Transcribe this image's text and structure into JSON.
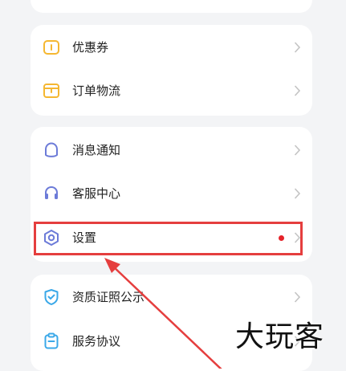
{
  "menu": {
    "group1": {
      "coupon": {
        "label": "优惠券",
        "icon": "coupon-icon"
      },
      "orders": {
        "label": "订单物流",
        "icon": "package-icon"
      }
    },
    "group2": {
      "notifications": {
        "label": "消息通知",
        "icon": "bell-icon"
      },
      "service": {
        "label": "客服中心",
        "icon": "headset-icon"
      },
      "settings": {
        "label": "设置",
        "icon": "settings-hexagon-icon",
        "has_badge": true
      }
    },
    "group3": {
      "license": {
        "label": "资质证照公示",
        "icon": "shield-check-icon"
      },
      "agreement": {
        "label": "服务协议",
        "icon": "clipboard-icon"
      }
    }
  },
  "colors": {
    "accent_icon": "#f5b731",
    "secondary_icon": "#6c7bd8",
    "badge": "#e5232a",
    "highlight": "#e53e3e"
  },
  "watermark": "大玩客"
}
